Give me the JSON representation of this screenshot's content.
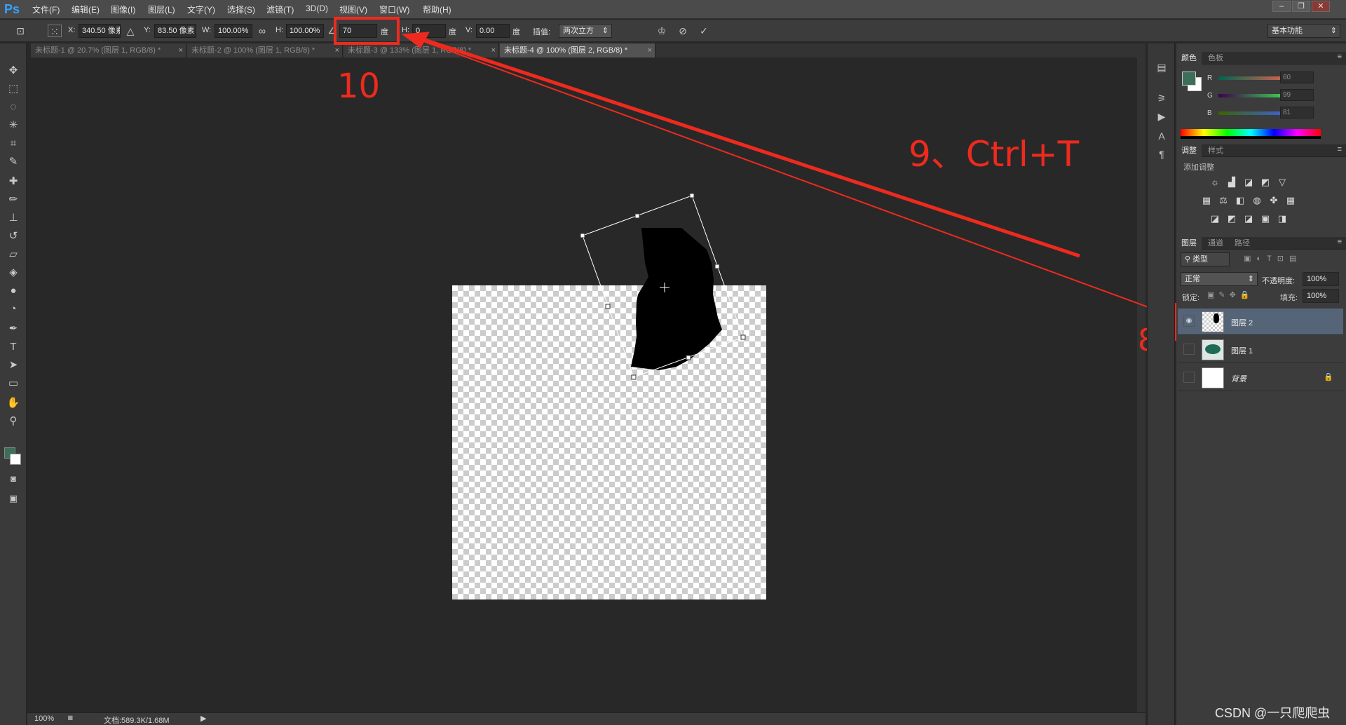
{
  "app": {
    "logo": "Ps",
    "menu": [
      "文件(F)",
      "编辑(E)",
      "图像(I)",
      "图层(L)",
      "文字(Y)",
      "选择(S)",
      "滤镜(T)",
      "3D(D)",
      "视图(V)",
      "窗口(W)",
      "帮助(H)"
    ],
    "window_buttons": [
      "–",
      "❐",
      "✕"
    ]
  },
  "options": {
    "x_label": "X:",
    "x_value": "340.50 像素",
    "y_label": "Y:",
    "y_value": "83.50 像素",
    "w_label": "W:",
    "w_value": "100.00%",
    "h_label": "H:",
    "h_value": "100.00%",
    "angle_value": "70",
    "angle_unit": "度",
    "hskew_label": "H:",
    "hskew_value": "0",
    "hskew_unit": "度",
    "vskew_label": "V:",
    "vskew_value": "0.00",
    "vskew_unit": "度",
    "interp_label": "插值:",
    "interp_value": "两次立方",
    "workspace": "基本功能"
  },
  "tabs": [
    {
      "label": "未标题-1 @ 20.7% (图层 1, RGB/8) *",
      "active": false
    },
    {
      "label": "未标题-2 @ 100% (图层 1, RGB/8) *",
      "active": false
    },
    {
      "label": "未标题-3 @ 133% (图层 1, RGB/8) *",
      "active": false
    },
    {
      "label": "未标题-4 @ 100% (图层 2, RGB/8) *",
      "active": true
    }
  ],
  "status": {
    "zoom": "100%",
    "doc_info": "文档:589.3K/1.68M"
  },
  "color_panel": {
    "tabs": [
      "颜色",
      "色板"
    ],
    "foreground": "#3c6e5a",
    "background": "#ffffff",
    "channels": [
      {
        "label": "R",
        "value": "60"
      },
      {
        "label": "G",
        "value": "99"
      },
      {
        "label": "B",
        "value": "81"
      }
    ]
  },
  "adjust_panel": {
    "tabs": [
      "调整",
      "样式"
    ],
    "subtitle": "添加调整"
  },
  "layers_panel": {
    "tabs": [
      "图层",
      "通道",
      "路径"
    ],
    "filter": "类型",
    "blend_mode": "正常",
    "opacity_label": "不透明度:",
    "opacity_value": "100%",
    "lock_label": "锁定:",
    "fill_label": "填充:",
    "fill_value": "100%",
    "layers": [
      {
        "name": "图层 2",
        "selected": true,
        "visible": true
      },
      {
        "name": "图层 1",
        "selected": false,
        "visible": false
      },
      {
        "name": "背景",
        "selected": false,
        "visible": false,
        "locked": true
      }
    ]
  },
  "annotations": {
    "step10": "10",
    "step9": "9、Ctrl+T",
    "step8": "8",
    "color": "#ee2a1e"
  },
  "watermark": "CSDN @一只爬爬虫"
}
